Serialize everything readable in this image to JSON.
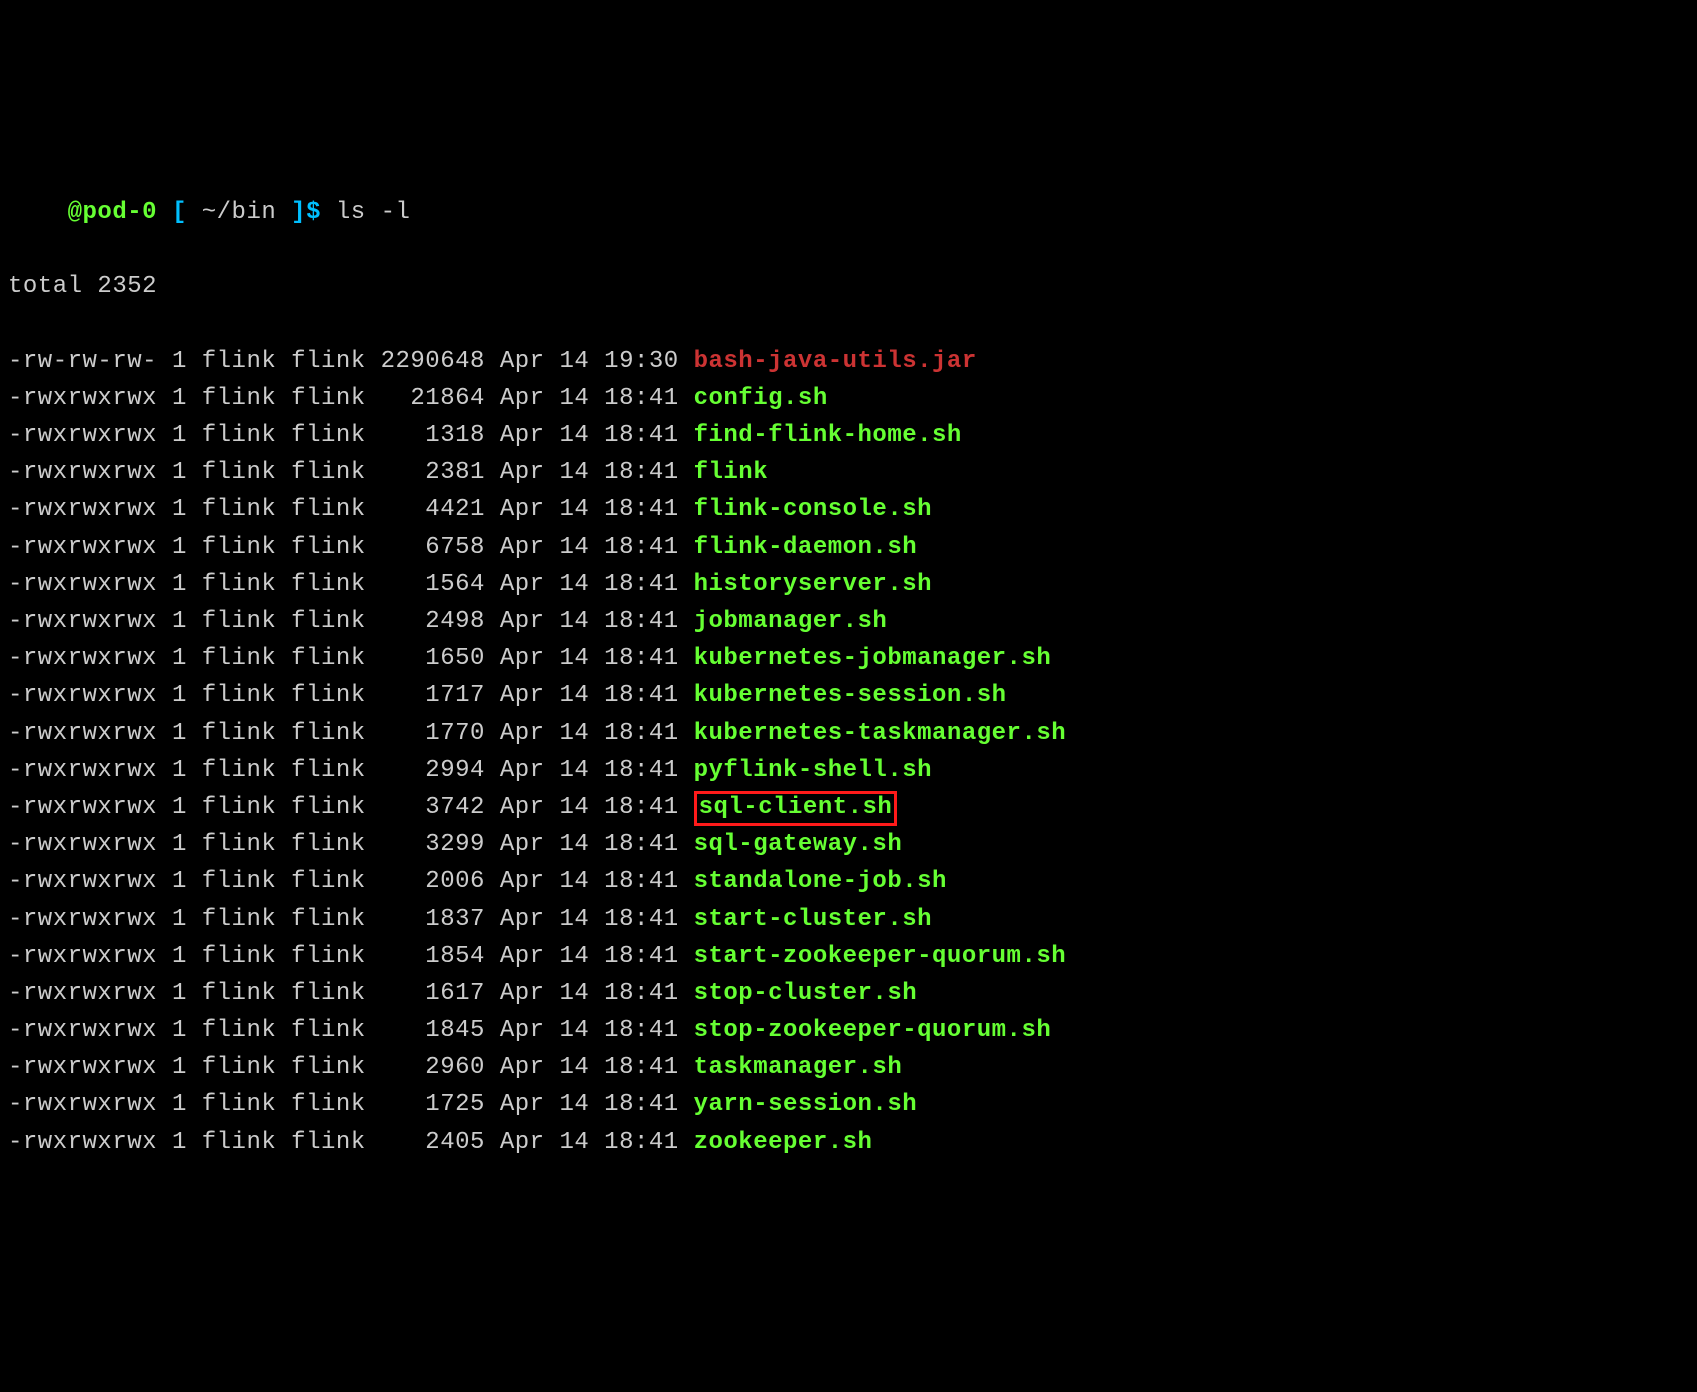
{
  "prompt": {
    "host": "@pod-0",
    "open_bracket": "[",
    "path": "~/bin",
    "close_bracket": "]$",
    "command": "ls -l"
  },
  "total_line": "total 2352",
  "files": [
    {
      "perm": "-rw-rw-rw-",
      "links": "1",
      "owner": "flink",
      "group": "flink",
      "size": "2290648",
      "month": "Apr",
      "day": "14",
      "time": "19:30",
      "name": "bash-java-utils.jar",
      "type": "regular",
      "highlighted": false
    },
    {
      "perm": "-rwxrwxrwx",
      "links": "1",
      "owner": "flink",
      "group": "flink",
      "size": "21864",
      "month": "Apr",
      "day": "14",
      "time": "18:41",
      "name": "config.sh",
      "type": "exec",
      "highlighted": false
    },
    {
      "perm": "-rwxrwxrwx",
      "links": "1",
      "owner": "flink",
      "group": "flink",
      "size": "1318",
      "month": "Apr",
      "day": "14",
      "time": "18:41",
      "name": "find-flink-home.sh",
      "type": "exec",
      "highlighted": false
    },
    {
      "perm": "-rwxrwxrwx",
      "links": "1",
      "owner": "flink",
      "group": "flink",
      "size": "2381",
      "month": "Apr",
      "day": "14",
      "time": "18:41",
      "name": "flink",
      "type": "exec",
      "highlighted": false
    },
    {
      "perm": "-rwxrwxrwx",
      "links": "1",
      "owner": "flink",
      "group": "flink",
      "size": "4421",
      "month": "Apr",
      "day": "14",
      "time": "18:41",
      "name": "flink-console.sh",
      "type": "exec",
      "highlighted": false
    },
    {
      "perm": "-rwxrwxrwx",
      "links": "1",
      "owner": "flink",
      "group": "flink",
      "size": "6758",
      "month": "Apr",
      "day": "14",
      "time": "18:41",
      "name": "flink-daemon.sh",
      "type": "exec",
      "highlighted": false
    },
    {
      "perm": "-rwxrwxrwx",
      "links": "1",
      "owner": "flink",
      "group": "flink",
      "size": "1564",
      "month": "Apr",
      "day": "14",
      "time": "18:41",
      "name": "historyserver.sh",
      "type": "exec",
      "highlighted": false
    },
    {
      "perm": "-rwxrwxrwx",
      "links": "1",
      "owner": "flink",
      "group": "flink",
      "size": "2498",
      "month": "Apr",
      "day": "14",
      "time": "18:41",
      "name": "jobmanager.sh",
      "type": "exec",
      "highlighted": false
    },
    {
      "perm": "-rwxrwxrwx",
      "links": "1",
      "owner": "flink",
      "group": "flink",
      "size": "1650",
      "month": "Apr",
      "day": "14",
      "time": "18:41",
      "name": "kubernetes-jobmanager.sh",
      "type": "exec",
      "highlighted": false
    },
    {
      "perm": "-rwxrwxrwx",
      "links": "1",
      "owner": "flink",
      "group": "flink",
      "size": "1717",
      "month": "Apr",
      "day": "14",
      "time": "18:41",
      "name": "kubernetes-session.sh",
      "type": "exec",
      "highlighted": false
    },
    {
      "perm": "-rwxrwxrwx",
      "links": "1",
      "owner": "flink",
      "group": "flink",
      "size": "1770",
      "month": "Apr",
      "day": "14",
      "time": "18:41",
      "name": "kubernetes-taskmanager.sh",
      "type": "exec",
      "highlighted": false
    },
    {
      "perm": "-rwxrwxrwx",
      "links": "1",
      "owner": "flink",
      "group": "flink",
      "size": "2994",
      "month": "Apr",
      "day": "14",
      "time": "18:41",
      "name": "pyflink-shell.sh",
      "type": "exec",
      "highlighted": false
    },
    {
      "perm": "-rwxrwxrwx",
      "links": "1",
      "owner": "flink",
      "group": "flink",
      "size": "3742",
      "month": "Apr",
      "day": "14",
      "time": "18:41",
      "name": "sql-client.sh",
      "type": "exec",
      "highlighted": true
    },
    {
      "perm": "-rwxrwxrwx",
      "links": "1",
      "owner": "flink",
      "group": "flink",
      "size": "3299",
      "month": "Apr",
      "day": "14",
      "time": "18:41",
      "name": "sql-gateway.sh",
      "type": "exec",
      "highlighted": false
    },
    {
      "perm": "-rwxrwxrwx",
      "links": "1",
      "owner": "flink",
      "group": "flink",
      "size": "2006",
      "month": "Apr",
      "day": "14",
      "time": "18:41",
      "name": "standalone-job.sh",
      "type": "exec",
      "highlighted": false
    },
    {
      "perm": "-rwxrwxrwx",
      "links": "1",
      "owner": "flink",
      "group": "flink",
      "size": "1837",
      "month": "Apr",
      "day": "14",
      "time": "18:41",
      "name": "start-cluster.sh",
      "type": "exec",
      "highlighted": false
    },
    {
      "perm": "-rwxrwxrwx",
      "links": "1",
      "owner": "flink",
      "group": "flink",
      "size": "1854",
      "month": "Apr",
      "day": "14",
      "time": "18:41",
      "name": "start-zookeeper-quorum.sh",
      "type": "exec",
      "highlighted": false
    },
    {
      "perm": "-rwxrwxrwx",
      "links": "1",
      "owner": "flink",
      "group": "flink",
      "size": "1617",
      "month": "Apr",
      "day": "14",
      "time": "18:41",
      "name": "stop-cluster.sh",
      "type": "exec",
      "highlighted": false
    },
    {
      "perm": "-rwxrwxrwx",
      "links": "1",
      "owner": "flink",
      "group": "flink",
      "size": "1845",
      "month": "Apr",
      "day": "14",
      "time": "18:41",
      "name": "stop-zookeeper-quorum.sh",
      "type": "exec",
      "highlighted": false
    },
    {
      "perm": "-rwxrwxrwx",
      "links": "1",
      "owner": "flink",
      "group": "flink",
      "size": "2960",
      "month": "Apr",
      "day": "14",
      "time": "18:41",
      "name": "taskmanager.sh",
      "type": "exec",
      "highlighted": false
    },
    {
      "perm": "-rwxrwxrwx",
      "links": "1",
      "owner": "flink",
      "group": "flink",
      "size": "1725",
      "month": "Apr",
      "day": "14",
      "time": "18:41",
      "name": "yarn-session.sh",
      "type": "exec",
      "highlighted": false
    },
    {
      "perm": "-rwxrwxrwx",
      "links": "1",
      "owner": "flink",
      "group": "flink",
      "size": "2405",
      "month": "Apr",
      "day": "14",
      "time": "18:41",
      "name": "zookeeper.sh",
      "type": "exec",
      "highlighted": false
    }
  ]
}
